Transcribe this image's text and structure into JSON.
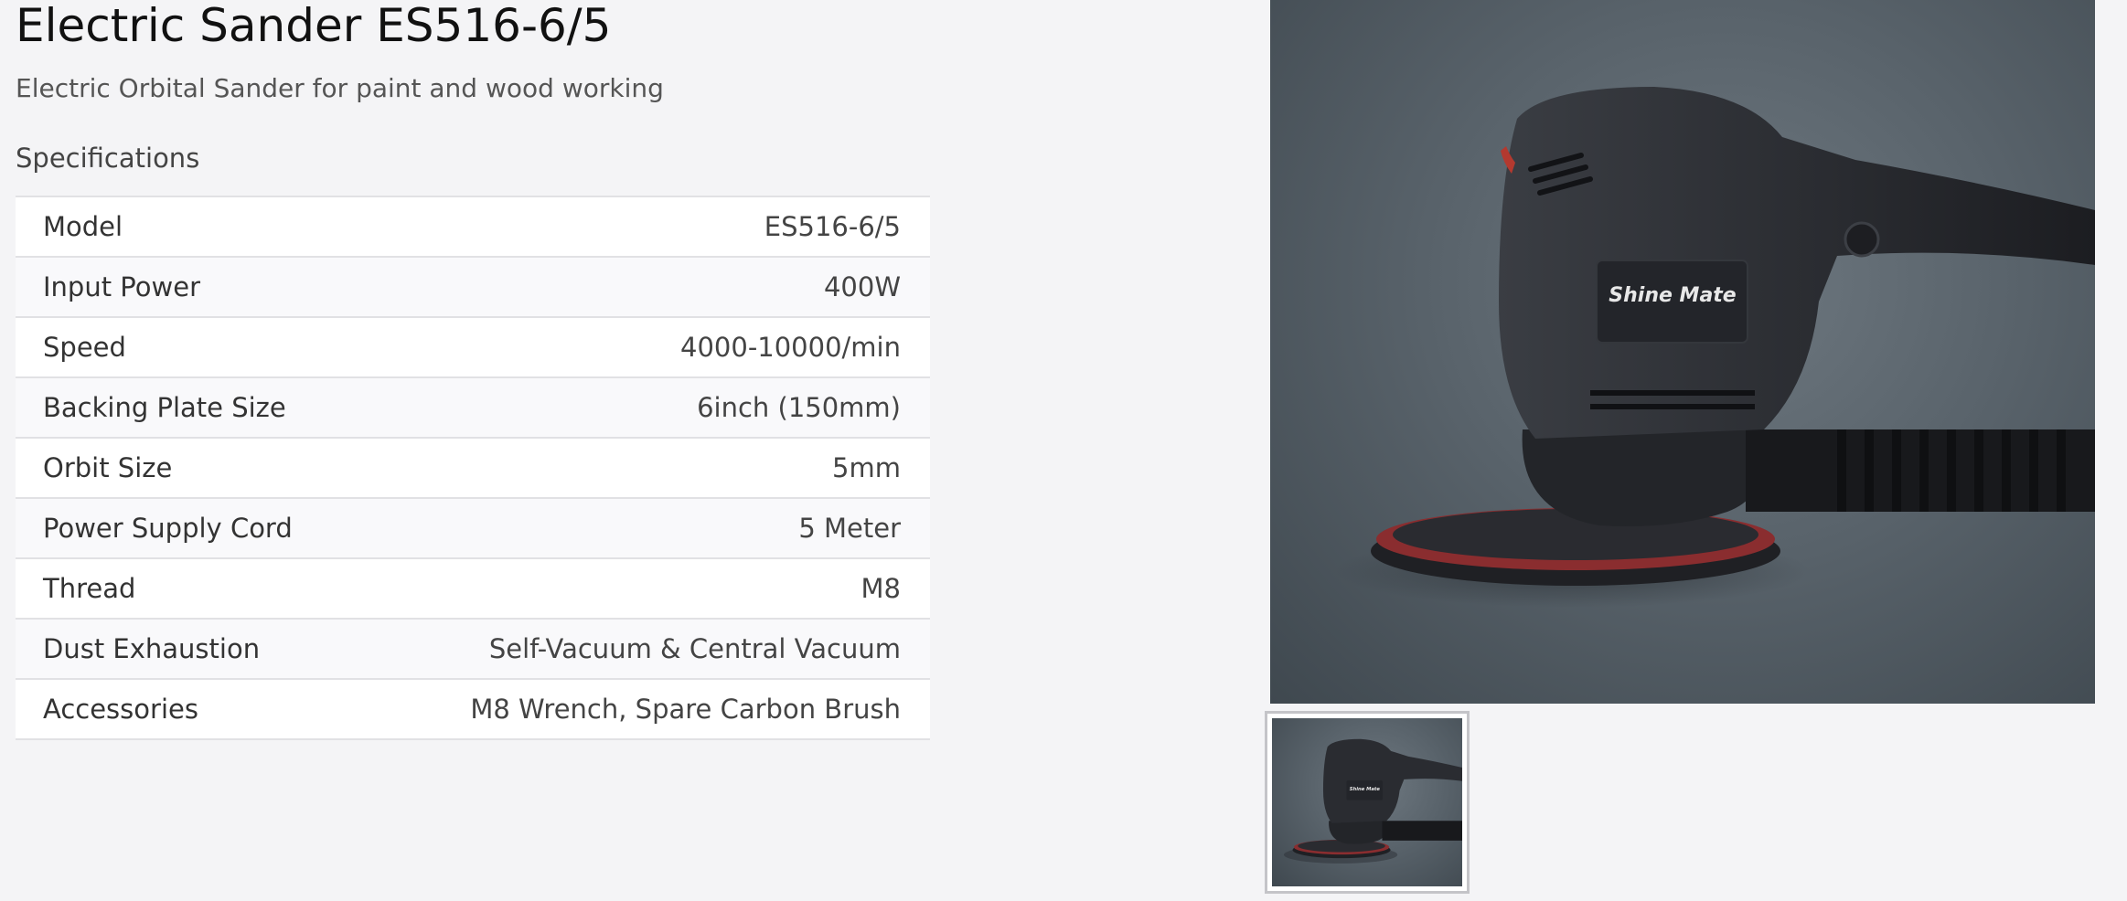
{
  "product": {
    "title": "Electric Sander ES516-6/5",
    "subtitle": "Electric Orbital Sander for paint and wood working"
  },
  "specs": {
    "heading": "Specifications",
    "rows": [
      {
        "key": "Model",
        "value": "ES516-6/5"
      },
      {
        "key": "Input Power",
        "value": "400W"
      },
      {
        "key": "Speed",
        "value": "4000-10000/min"
      },
      {
        "key": "Backing Plate Size",
        "value": "6inch (150mm)"
      },
      {
        "key": "Orbit Size",
        "value": "5mm"
      },
      {
        "key": "Power Supply Cord",
        "value": "5 Meter"
      },
      {
        "key": "Thread",
        "value": "M8"
      },
      {
        "key": "Dust Exhaustion",
        "value": "Self-Vacuum & Central Vacuum"
      },
      {
        "key": "Accessories",
        "value": "M8 Wrench, Spare Carbon Brush"
      }
    ]
  },
  "gallery": {
    "brand_logo": "Shine Mate",
    "thumbnails": 1
  }
}
